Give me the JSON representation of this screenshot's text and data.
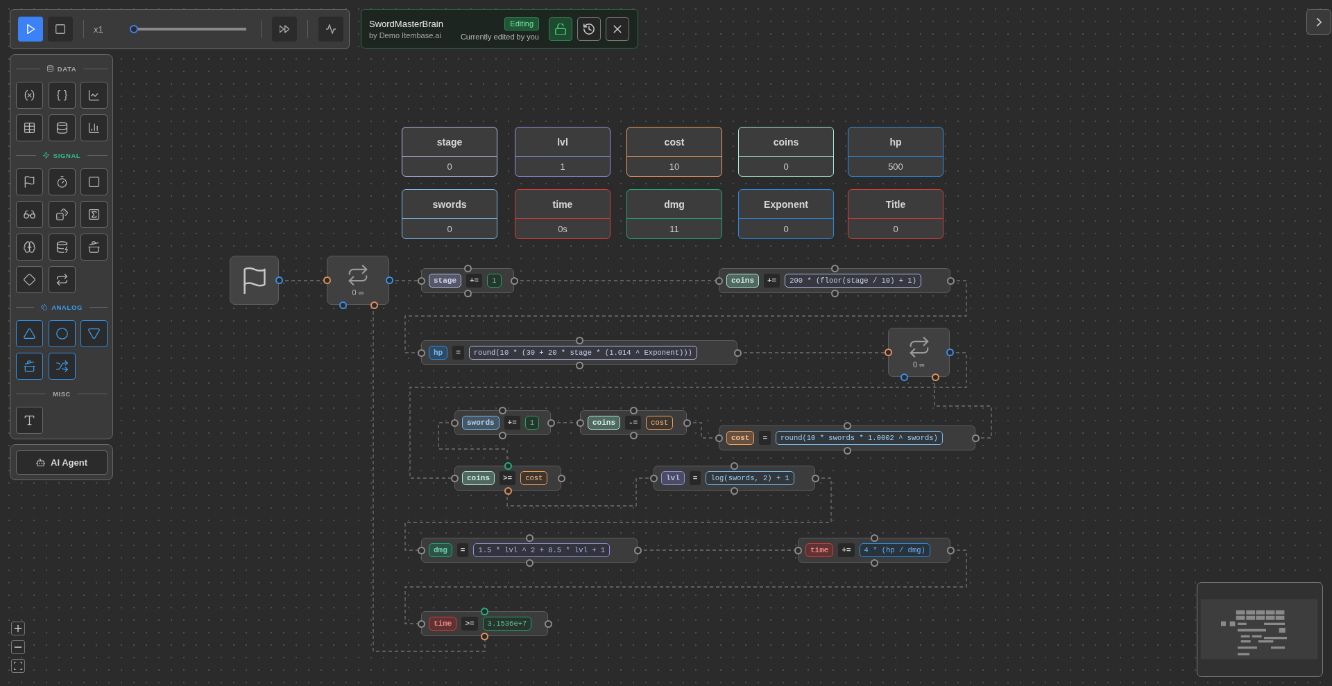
{
  "toolbar": {
    "playback": [
      {
        "kind": "play",
        "on": true
      },
      {
        "kind": "stop",
        "on": false
      }
    ],
    "speed": {
      "label": "x1",
      "level": 0
    },
    "actions": [
      {
        "kind": "fast-forward",
        "on": false
      },
      {
        "kind": "pulse",
        "on": false
      }
    ]
  },
  "brain": {
    "title": "SwordMasterBrain",
    "owner": "by Demo Itembase.ai",
    "badge": "Editing",
    "status": "Currently edited by you",
    "buttons": [
      {
        "kind": "unlock",
        "on": true
      },
      {
        "kind": "history",
        "on": false
      },
      {
        "kind": "close",
        "on": false
      }
    ]
  },
  "palette": {
    "sections": [
      {
        "kind": "data",
        "title": "DATA"
      },
      {
        "kind": "signal",
        "title": "SIGNAL"
      },
      {
        "kind": "analog",
        "title": "ANALOG"
      },
      {
        "kind": "misc",
        "title": "MISC"
      }
    ]
  },
  "ai_agent": {
    "label": "AI Agent"
  },
  "variables": [
    {
      "name": "stage",
      "value": "0",
      "color": "#b4b6ea"
    },
    {
      "name": "lvl",
      "value": "1",
      "color": "#8e90e0"
    },
    {
      "name": "cost",
      "value": "10",
      "color": "#f0a060"
    },
    {
      "name": "coins",
      "value": "0",
      "color": "#a6ecd2"
    },
    {
      "name": "hp",
      "value": "500",
      "color": "#2d8fe6"
    },
    {
      "name": "swords",
      "value": "0",
      "color": "#7ab8e6"
    },
    {
      "name": "time",
      "value": "0s",
      "color": "#d83a3a"
    },
    {
      "name": "dmg",
      "value": "11",
      "color": "#22a87a"
    },
    {
      "name": "Exponent",
      "value": "0",
      "color": "#2b88e0"
    },
    {
      "name": "Title",
      "value": "0",
      "color": "#d43b3b"
    }
  ],
  "nodes": [
    {
      "kind": "start"
    },
    {
      "kind": "loop",
      "label": "0 ∞"
    },
    {
      "kind": "assign",
      "target": {
        "text": "stage",
        "color": "#b4b6ea"
      },
      "operator": "+=",
      "value": {
        "text": "1",
        "color": "#22a362"
      }
    },
    {
      "kind": "assign",
      "target": {
        "text": "coins",
        "color": "#a6ecd2"
      },
      "operator": "+=",
      "value": {
        "text": "200 * (floor(stage / 10) + 1)",
        "color": "#b4b6ea"
      }
    },
    {
      "kind": "assign",
      "target": {
        "text": "hp",
        "color": "#2d8fe6"
      },
      "operator": "=",
      "value": {
        "text": "round(10 * (30 + 20 * stage * (1.014 ^ Exponent)))",
        "color": "#b4b6ea"
      }
    },
    {
      "kind": "loop",
      "label": "0 ∞"
    },
    {
      "kind": "assign",
      "target": {
        "text": "swords",
        "color": "#7ab8e6"
      },
      "operator": "+=",
      "value": {
        "text": "1",
        "color": "#22a362"
      }
    },
    {
      "kind": "assign",
      "target": {
        "text": "coins",
        "color": "#a6ecd2"
      },
      "operator": "-=",
      "value": {
        "text": "cost",
        "color": "#f0a060"
      }
    },
    {
      "kind": "assign",
      "target": {
        "text": "cost",
        "color": "#f0a060"
      },
      "operator": "=",
      "value": {
        "text": "round(10 * swords * 1.0002 ^ swords)",
        "color": "#7ab8e6"
      }
    },
    {
      "kind": "compare",
      "target": {
        "text": "coins",
        "color": "#a6ecd2"
      },
      "operator": ">=",
      "value": {
        "text": "cost",
        "color": "#f0a060"
      }
    },
    {
      "kind": "assign",
      "target": {
        "text": "lvl",
        "color": "#8e90e0"
      },
      "operator": "=",
      "value": {
        "text": "log(swords, 2) + 1",
        "color": "#7ab8e6"
      }
    },
    {
      "kind": "assign",
      "target": {
        "text": "dmg",
        "color": "#22a87a"
      },
      "operator": "=",
      "value": {
        "text": "1.5 * lvl ^ 2 + 8.5 * lvl + 1",
        "color": "#8e90e0"
      }
    },
    {
      "kind": "assign",
      "target": {
        "text": "time",
        "color": "#d83a3a"
      },
      "operator": "+=",
      "value": {
        "text": "4 * (hp / dmg)",
        "color": "#2d8fe6"
      }
    },
    {
      "kind": "compare",
      "target": {
        "text": "time",
        "color": "#d83a3a"
      },
      "operator": ">=",
      "value": {
        "text": "3.1536e+7",
        "color": "#22a362"
      }
    }
  ]
}
